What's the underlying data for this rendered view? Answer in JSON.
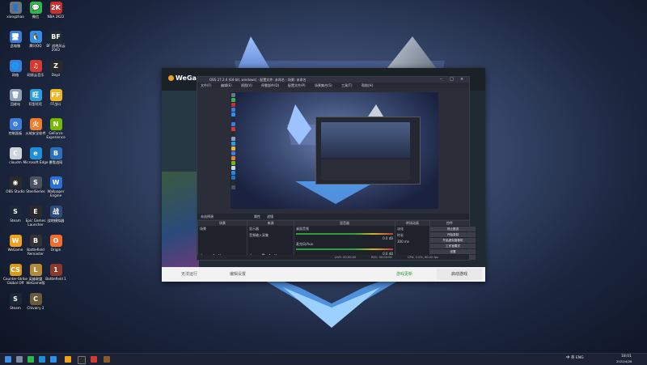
{
  "desktop_icons": [
    {
      "label": "xiangzhao",
      "color": "#6a7380",
      "glyph": "👤"
    },
    {
      "label": "微信",
      "color": "#2fb84a",
      "glyph": "💬"
    },
    {
      "label": "NBA 2K22",
      "color": "#c9302c",
      "glyph": "2K"
    },
    {
      "label": "此电脑",
      "color": "#3b7dd8",
      "glyph": "🖥"
    },
    {
      "label": "腾讯QQ",
      "color": "#2e8fe8",
      "glyph": "🐧"
    },
    {
      "label": "BF 战地风云2042",
      "color": "#1f2b34",
      "glyph": "BF"
    },
    {
      "label": "网络",
      "color": "#3b7dd8",
      "glyph": "🌐"
    },
    {
      "label": "网易云音乐",
      "color": "#d33a31",
      "glyph": "♫"
    },
    {
      "label": "Dayz",
      "color": "#2a2a2a",
      "glyph": "Z"
    },
    {
      "label": "回收站",
      "color": "#8ca0b8",
      "glyph": "🗑"
    },
    {
      "label": "阿里旺旺",
      "color": "#2d9be0",
      "glyph": "旺"
    },
    {
      "label": "FF战斗",
      "color": "#f0b623",
      "glyph": "FF"
    },
    {
      "label": "控制面板",
      "color": "#3b7dd8",
      "glyph": "⚙"
    },
    {
      "label": "火绒安全软件",
      "color": "#f07d2e",
      "glyph": "火"
    },
    {
      "label": "GeForce Experience",
      "color": "#76b900",
      "glyph": "N"
    },
    {
      "label": "cloudm",
      "color": "#d0d4dc",
      "glyph": "C"
    },
    {
      "label": "Microsoft Edge",
      "color": "#1e8ed8",
      "glyph": "e"
    },
    {
      "label": "暴雪战网",
      "color": "#2b6fbf",
      "glyph": "B"
    },
    {
      "label": "OBS Studio",
      "color": "#2a2a2a",
      "glyph": "◉"
    },
    {
      "label": "SteelSeries",
      "color": "#4b5360",
      "glyph": "S"
    },
    {
      "label": "Wallpaper Engine",
      "color": "#2b6fd8",
      "glyph": "W"
    },
    {
      "label": "Steam",
      "color": "#1b2838",
      "glyph": "S"
    },
    {
      "label": "Epic Games Launcher",
      "color": "#2a2a2a",
      "glyph": "E"
    },
    {
      "label": "战地模拟器",
      "color": "#2f4b7b",
      "glyph": "战"
    },
    {
      "label": "WeGame",
      "color": "#f2a020",
      "glyph": "W"
    },
    {
      "label": "Battlefield Remaster",
      "color": "#333",
      "glyph": "B"
    },
    {
      "label": "Origin",
      "color": "#f56c2d",
      "glyph": "O"
    },
    {
      "label": "Counter-Strike Global Off",
      "color": "#d69a1f",
      "glyph": "CS"
    },
    {
      "label": "英雄联盟 WeGame版",
      "color": "#b48a3c",
      "glyph": "L"
    },
    {
      "label": "Battlefield 1",
      "color": "#8b3a2a",
      "glyph": "1"
    },
    {
      "label": "Steam",
      "color": "#1b2838",
      "glyph": "S"
    },
    {
      "label": "Chivalry 2",
      "color": "#6b5a3a",
      "glyph": "C"
    }
  ],
  "wegame": {
    "logo": "WeGame",
    "bottom_left": "无法运行",
    "bottom_mid": "编辑设置",
    "bottom_status": "游戏更新",
    "launch": "启动游戏"
  },
  "obs": {
    "title": "OBS 27.2.4 (64-bit, windows) - 配置文件: 未命名 - 场景: 未命名",
    "menu": [
      "文件(F)",
      "编辑(E)",
      "视图(V)",
      "停靠部件(D)",
      "配置文件(P)",
      "场景集合(S)",
      "工具(T)",
      "帮助(H)"
    ],
    "scene_label": "未选择源",
    "scene_props": "属性",
    "scene_filters": "滤镜",
    "docks": {
      "scenes": {
        "header": "场景",
        "items": [
          "场景"
        ]
      },
      "sources": {
        "header": "来源",
        "items": [
          "显示器",
          "音频输入采集"
        ]
      },
      "mixer": {
        "header": "混音器",
        "tracks": [
          {
            "name": "桌面音频",
            "db": "0.0 dB"
          },
          {
            "name": "麦克风/Aux",
            "db": "0.0 dB"
          }
        ]
      },
      "transitions": {
        "header": "转场动画",
        "type": "淡化",
        "duration_label": "时长",
        "duration": "300 ms"
      },
      "controls": {
        "header": "控件",
        "buttons": [
          "停止推流",
          "开始录制",
          "开始虚拟摄像机",
          "工作室模式",
          "设置",
          "退出"
        ]
      }
    },
    "status": {
      "live": "LIVE: 00:00:00",
      "rec": "REC: 00:00:00",
      "cpu": "CPU: 2.0%, 60.00 fps"
    }
  },
  "taskbar": {
    "clock_time": "18:01",
    "clock_date": "2022/4/28",
    "tray_text": "中 英 ENG"
  }
}
